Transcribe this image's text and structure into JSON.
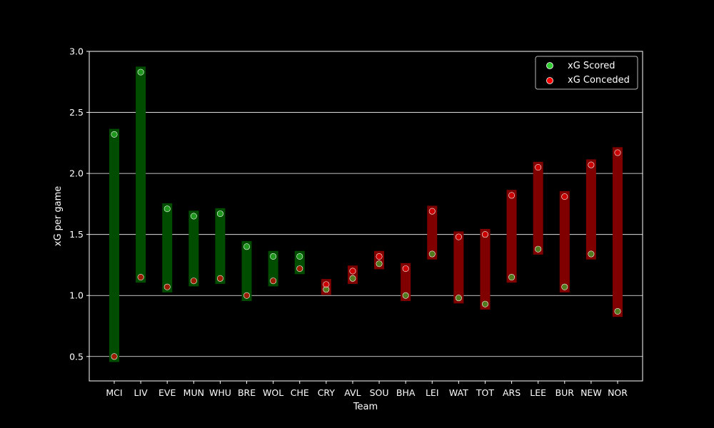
{
  "chart_data": {
    "type": "scatter",
    "title": "",
    "xlabel": "Team",
    "ylabel": "xG per game",
    "ylim": [
      0.3,
      3.0
    ],
    "yticks": [
      "0.5",
      "1.0",
      "1.5",
      "2.0",
      "2.5",
      "3.0"
    ],
    "grid": "horizontal",
    "legend_position": "top-right",
    "colors": {
      "background": "#000000",
      "scored": "#32cd32",
      "conceded": "#ff0000",
      "bar_green": "#004d00",
      "bar_red": "#800000",
      "text": "#ffffff"
    },
    "categories": [
      "MCI",
      "LIV",
      "EVE",
      "MUN",
      "WHU",
      "BRE",
      "WOL",
      "CHE",
      "CRY",
      "AVL",
      "SOU",
      "BHA",
      "LEI",
      "WAT",
      "TOT",
      "ARS",
      "LEE",
      "BUR",
      "NEW",
      "NOR"
    ],
    "series": [
      {
        "name": "xG Scored",
        "values": [
          2.32,
          2.83,
          1.71,
          1.65,
          1.67,
          1.4,
          1.32,
          1.32,
          1.05,
          1.14,
          1.26,
          1.0,
          1.34,
          0.98,
          0.93,
          1.15,
          1.38,
          1.07,
          1.34,
          0.87
        ]
      },
      {
        "name": "xG Conceded",
        "values": [
          0.5,
          1.15,
          1.07,
          1.12,
          1.14,
          1.0,
          1.12,
          1.22,
          1.09,
          1.2,
          1.32,
          1.22,
          1.69,
          1.48,
          1.5,
          1.82,
          2.05,
          1.81,
          2.07,
          2.17
        ]
      }
    ]
  }
}
